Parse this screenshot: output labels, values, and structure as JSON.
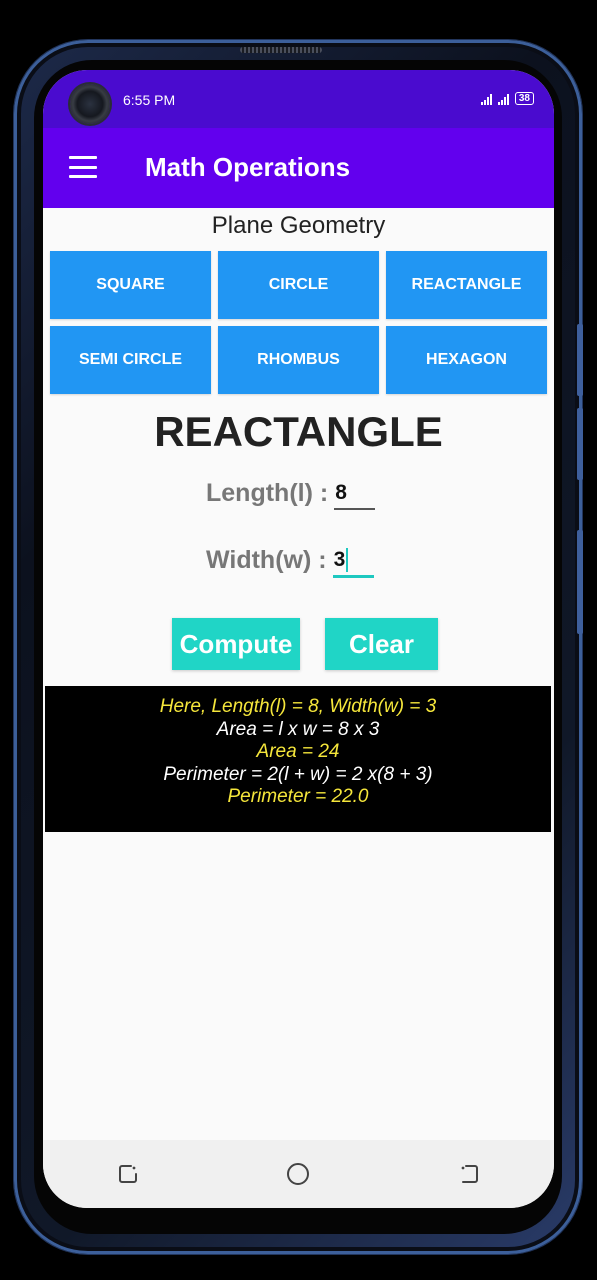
{
  "status_bar": {
    "time": "6:55 PM",
    "battery": "38"
  },
  "app_bar": {
    "title": "Math Operations",
    "menu_icon": "hamburger-menu-icon"
  },
  "main": {
    "section_title": "Plane Geometry",
    "shapes": [
      "SQUARE",
      "CIRCLE",
      "REACTANGLE",
      "SEMI CIRCLE",
      "RHOMBUS",
      "HEXAGON"
    ],
    "selected_shape": "REACTANGLE",
    "length_label": "Length(l) :",
    "length_value": "8",
    "width_label": "Width(w) :",
    "width_value": "3",
    "compute_label": "Compute",
    "clear_label": "Clear"
  },
  "result": {
    "lines": [
      {
        "text": "Here, Length(l) = 8, Width(w) = 3",
        "color": "#f5e63b"
      },
      {
        "text": "Area = l x w = 8 x 3",
        "color": "#ffffff"
      },
      {
        "text": "Area = 24",
        "color": "#f5e63b"
      },
      {
        "text": "Perimeter = 2(l + w) = 2 x(8 + 3)",
        "color": "#ffffff"
      },
      {
        "text": "Perimeter = 22.0",
        "color": "#f5e63b"
      }
    ]
  },
  "colors": {
    "status_bar": "#4a0bcf",
    "app_bar": "#6200ee",
    "shape_button": "#2196f3",
    "action_button": "#20d5c6",
    "highlight_text": "#f5e63b"
  },
  "nav_bar": {
    "icons": [
      "recents-icon",
      "home-icon",
      "back-icon"
    ]
  }
}
